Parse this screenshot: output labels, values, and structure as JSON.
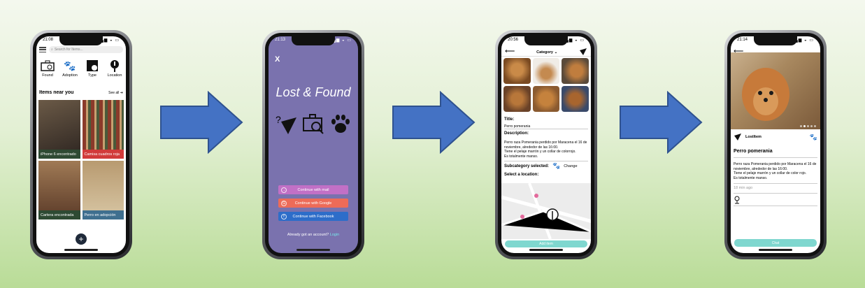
{
  "colors": {
    "arrow": "#4472c4",
    "purple": "#7a72ae",
    "teal": "#7fd7cf"
  },
  "screen1": {
    "time": "21:08",
    "search_placeholder": "Search for Items...",
    "categories": [
      {
        "label": "Found",
        "icon": "briefcase-icon"
      },
      {
        "label": "Adoption",
        "icon": "paw-icon"
      },
      {
        "label": "Type",
        "icon": "type-icon"
      },
      {
        "label": "Location",
        "icon": "location-icon"
      }
    ],
    "near_title": "Items near you",
    "see_all": "See all",
    "items": [
      {
        "label": "iPhone 6 encontrado",
        "color": "#2e4a33"
      },
      {
        "label": "Camisa cuadros roja",
        "color": "#d13a3a"
      },
      {
        "label": "Cartera encontrada",
        "color": "#2e4a33"
      },
      {
        "label": "Perro en adopción",
        "color": "#3f6f8f"
      }
    ],
    "fab": "+"
  },
  "screen2": {
    "time": "21:13",
    "close": "X",
    "title": "Lost & Found",
    "buttons": [
      {
        "label": "Continue with mail",
        "color": "#c270c6"
      },
      {
        "label": "Continue with Google",
        "color": "#ed6b58"
      },
      {
        "label": "Continue with Facebook",
        "color": "#2d6dc9"
      }
    ],
    "account_text": "Already got an account?",
    "login": "Login"
  },
  "screen3": {
    "time": "20:56",
    "category": "Category",
    "title_label": "Title:",
    "title_value": "Perro pomerania",
    "desc_label": "Description:",
    "desc_lines": [
      "Perro raza Pomerania perdido por Maracena el 16 de",
      "noviembre, alrededor de las 16:00.",
      "Tiene el pelaje marrón y un collar de colorrojo.",
      "Es totalmente manso."
    ],
    "sub_label": "Subcategory selected:",
    "change": "Change",
    "loc_label": "Select a location:",
    "add_item": "Add item"
  },
  "screen4": {
    "time": "21:14",
    "type": "LostItem",
    "title": "Perro pomerania",
    "desc_lines": [
      "Perro raza Pomerania perdido por Maracena el 16 de",
      "noviembre, alrededor de las 16:00.",
      "Tiene el pelaje marrón y un collar de color rojo.",
      "Es totalmente manso."
    ],
    "ago": "18 min ago",
    "chat": "Chat"
  }
}
